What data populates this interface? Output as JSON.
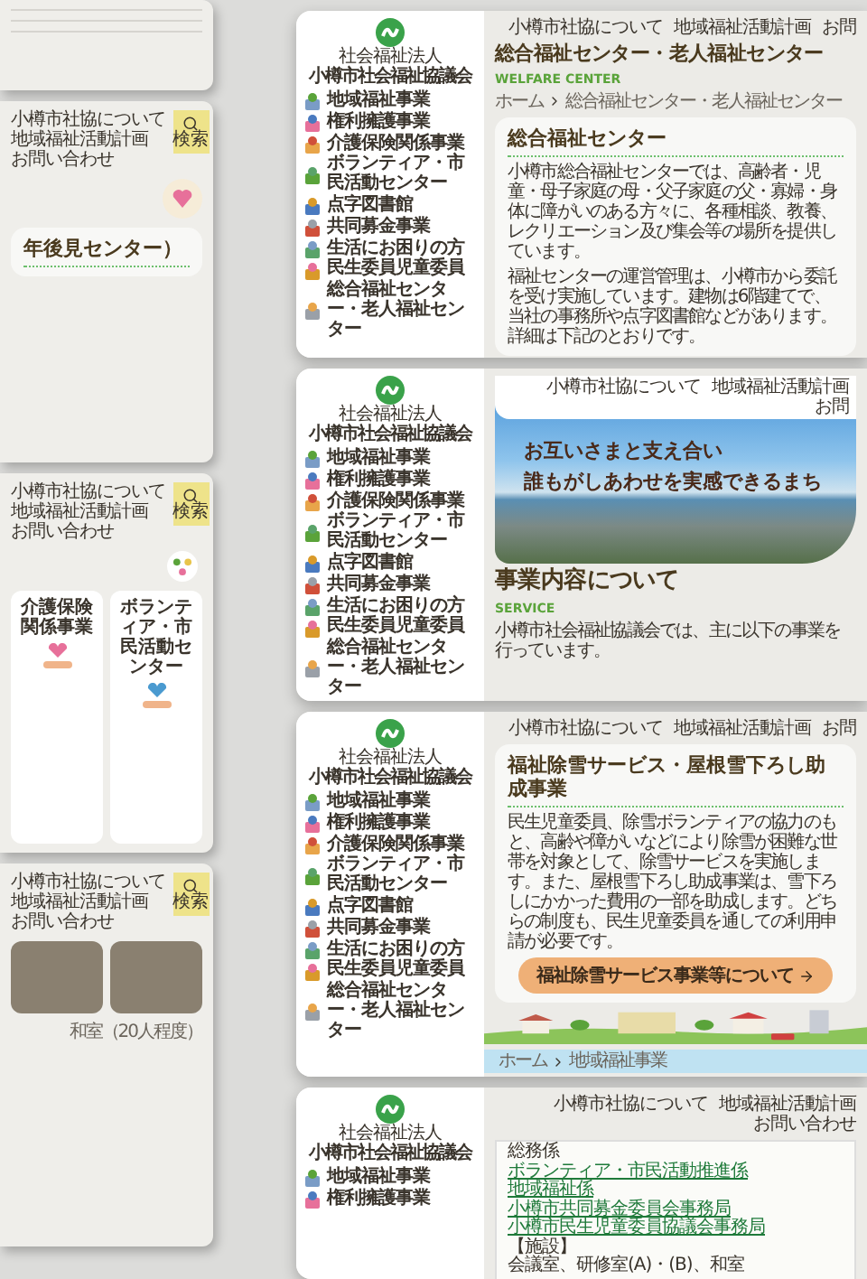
{
  "left_cards": [
    {
      "kind": "blank"
    },
    {
      "kind": "article",
      "nav": [
        "小樽市社協について",
        "地域福祉活動計画",
        "お問い合わせ"
      ],
      "search_label": "検索",
      "heading": "年後見センター）"
    },
    {
      "kind": "services",
      "nav": [
        "小樽市社協について",
        "地域福祉活動計画",
        "お問い合わせ"
      ],
      "search_label": "検索",
      "services": [
        {
          "title": "介護保険関係事業"
        },
        {
          "title": "ボランティア・市民活動センター"
        }
      ]
    },
    {
      "kind": "gallery",
      "nav": [
        "小樽市社協について",
        "地域福祉活動計画",
        "お問い合わせ"
      ],
      "search_label": "検索",
      "caption": "和室（20人程度）"
    }
  ],
  "right_cards": [
    {
      "kind": "center",
      "org_type": "社会福祉法人",
      "org_name": "小樽市社会福祉協議会",
      "sidebar": [
        "地域福祉事業",
        "権利擁護事業",
        "介護保険関係事業",
        "ボランティア・市民活動センター",
        "点字図書館",
        "共同募金事業",
        "生活にお困りの方",
        "民生委員児童委員",
        "総合福祉センター・老人福祉センター"
      ],
      "nav": [
        "小樽市社協について",
        "地域福祉活動計画",
        "お問"
      ],
      "title": "総合福祉センター・老人福祉センター",
      "subtitle": "WELFARE CENTER",
      "breadcrumb": [
        "ホーム",
        "総合福祉センター・老人福祉センター"
      ],
      "section_heading": "総合福祉センター",
      "paragraphs": [
        "小樽市総合福祉センターでは、高齢者・児童・母子家庭の母・父子家庭の父・寡婦・身体に障がいのある方々に、各種相談、教養、レクリエーション及び集会等の場所を提供しています。",
        "福祉センターの運営管理は、小樽市から委託を受け実施しています。建物は6階建てで、当社の事務所や点字図書館などがあります。詳細は下記のとおりです。"
      ]
    },
    {
      "kind": "home",
      "org_type": "社会福祉法人",
      "org_name": "小樽市社会福祉協議会",
      "sidebar": [
        "地域福祉事業",
        "権利擁護事業",
        "介護保険関係事業",
        "ボランティア・市民活動センター",
        "点字図書館",
        "共同募金事業",
        "生活にお困りの方",
        "民生委員児童委員",
        "総合福祉センター・老人福祉センター"
      ],
      "nav": [
        "小樽市社協について",
        "地域福祉活動計画",
        "お問"
      ],
      "hero_lines": [
        "お互いさまと支え合い",
        "誰もがしあわせを実感できるまち"
      ],
      "title": "事業内容について",
      "subtitle": "SERVICE",
      "intro": "小樽市社会福祉協議会では、主に以下の事業を行っています。"
    },
    {
      "kind": "snow",
      "org_type": "社会福祉法人",
      "org_name": "小樽市社会福祉協議会",
      "sidebar": [
        "地域福祉事業",
        "権利擁護事業",
        "介護保険関係事業",
        "ボランティア・市民活動センター",
        "点字図書館",
        "共同募金事業",
        "生活にお困りの方",
        "民生委員児童委員",
        "総合福祉センター・老人福祉センター"
      ],
      "nav": [
        "小樽市社協について",
        "地域福祉活動計画",
        "お問"
      ],
      "title": "福祉除雪サービス・屋根雪下ろし助成事業",
      "paragraph": "民生児童委員、除雪ボランティアの協力のもと、高齢や障がいなどにより除雪が困難な世帯を対象として、除雪サービスを実施します。また、屋根雪下ろし助成事業は、雪下ろしにかかった費用の一部を助成します。どちらの制度も、民生児童委員を通しての利用申請が必要です。",
      "button": "福祉除雪サービス事業等について",
      "breadcrumb": [
        "ホーム",
        "地域福祉事業"
      ]
    },
    {
      "kind": "office",
      "org_type": "社会福祉法人",
      "org_name": "小樽市社会福祉協議会",
      "sidebar": [
        "地域福祉事業",
        "権利擁護事業"
      ],
      "nav": [
        "小樽市社協について",
        "地域福祉活動計画",
        "お問い合わせ"
      ],
      "lines": [
        {
          "kind": "text",
          "text": "総務係"
        },
        {
          "kind": "link",
          "text": "ボランティア・市民活動推進係"
        },
        {
          "kind": "link",
          "text": "地域福祉係"
        },
        {
          "kind": "link",
          "text": "小樽市共同募金委員会事務局"
        },
        {
          "kind": "link",
          "text": "小樽市民生児童委員協議会事務局"
        },
        {
          "kind": "text",
          "text": "【施設】"
        },
        {
          "kind": "text",
          "text": "会議室、研修室(A)・(B)、和室"
        }
      ]
    }
  ]
}
